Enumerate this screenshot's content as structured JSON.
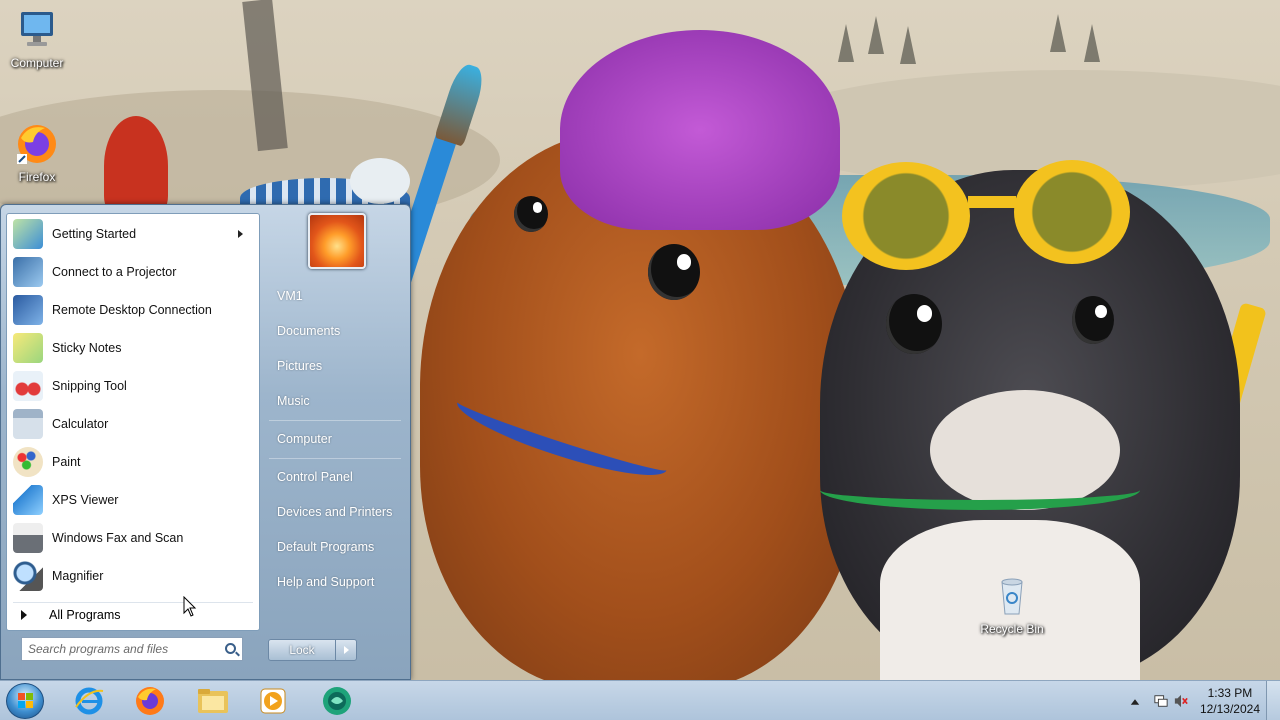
{
  "desktop": {
    "icons": [
      {
        "label": "Computer"
      },
      {
        "label": "Firefox"
      },
      {
        "label": "Recycle Bin"
      }
    ]
  },
  "start_menu": {
    "programs": [
      {
        "label": "Getting Started",
        "icon": "getting-started-icon",
        "has_submenu": true
      },
      {
        "label": "Connect to a Projector",
        "icon": "projector-icon"
      },
      {
        "label": "Remote Desktop Connection",
        "icon": "remote-desktop-icon"
      },
      {
        "label": "Sticky Notes",
        "icon": "sticky-notes-icon"
      },
      {
        "label": "Snipping Tool",
        "icon": "scissors-icon"
      },
      {
        "label": "Calculator",
        "icon": "calculator-icon"
      },
      {
        "label": "Paint",
        "icon": "paint-palette-icon"
      },
      {
        "label": "XPS Viewer",
        "icon": "xps-viewer-icon"
      },
      {
        "label": "Windows Fax and Scan",
        "icon": "fax-icon"
      },
      {
        "label": "Magnifier",
        "icon": "magnifier-icon"
      }
    ],
    "all_programs": "All Programs",
    "search_placeholder": "Search programs and files",
    "places": [
      "VM1",
      "Documents",
      "Pictures",
      "Music",
      "Computer",
      "Control Panel",
      "Devices and Printers",
      "Default Programs",
      "Help and Support"
    ],
    "lock_label": "Lock"
  },
  "taskbar": {
    "pinned": [
      "internet-explorer-icon",
      "firefox-icon",
      "file-explorer-icon",
      "media-player-icon",
      "chat-app-icon"
    ],
    "clock_time": "1:33 PM",
    "clock_date": "12/13/2024"
  },
  "colors": {
    "menu_blue": "#8aa4bd",
    "taskbar": "#aec4db"
  }
}
